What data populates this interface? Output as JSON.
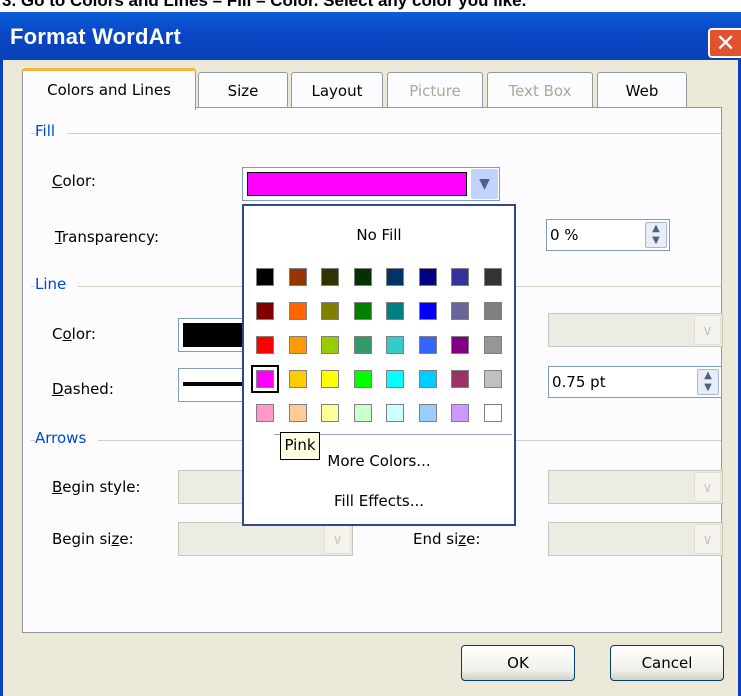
{
  "header": {
    "instruction_fragment": "3. Go to Colors and Lines – Fill – Color. Select any color you like."
  },
  "window": {
    "title": "Format WordArt",
    "close_glyph": "✕"
  },
  "tabs": [
    {
      "label": "Colors and Lines",
      "active": true,
      "enabled": true
    },
    {
      "label": "Size",
      "enabled": true
    },
    {
      "label": "Layout",
      "enabled": true
    },
    {
      "label": "Picture",
      "enabled": false
    },
    {
      "label": "Text Box",
      "enabled": false
    },
    {
      "label": "Web",
      "enabled": true
    }
  ],
  "fill": {
    "section_label": "Fill",
    "color_label": "Color:",
    "color_value": "#ff00ff",
    "transparency_label": "Transparency:",
    "transparency_value": "0 %"
  },
  "line": {
    "section_label": "Line",
    "color_label": "Color:",
    "color_value": "#000000",
    "dashed_label": "Dashed:",
    "weight_value": "0.75 pt"
  },
  "arrows": {
    "section_label": "Arrows",
    "begin_style_label": "Begin style:",
    "begin_size_label": "Begin size:",
    "end_size_label": "End size:"
  },
  "palette": {
    "no_fill_label": "No Fill",
    "rows": [
      [
        "#000000",
        "#993300",
        "#333300",
        "#003300",
        "#003366",
        "#000080",
        "#333399",
        "#333333"
      ],
      [
        "#800000",
        "#ff6600",
        "#808000",
        "#008000",
        "#008080",
        "#0000ff",
        "#666699",
        "#808080"
      ],
      [
        "#ff0000",
        "#ff9900",
        "#99cc00",
        "#339966",
        "#33cccc",
        "#3366ff",
        "#800080",
        "#969696"
      ],
      [
        "#ff00ff",
        "#ffcc00",
        "#ffff00",
        "#00ff00",
        "#00ffff",
        "#00ccff",
        "#993366",
        "#c0c0c0"
      ],
      [
        "#ff99cc",
        "#ffcc99",
        "#ffff99",
        "#ccffcc",
        "#ccffff",
        "#99ccff",
        "#cc99ff",
        "#ffffff"
      ]
    ],
    "selected": "#ff00ff",
    "more_colors_label": "More Colors...",
    "fill_effects_label": "Fill Effects...",
    "tooltip": "Pink"
  },
  "buttons": {
    "ok": "OK",
    "cancel": "Cancel"
  },
  "icons": {
    "dropdown_arrow": "chevron-down-icon",
    "spin": "spin-updown-icon",
    "close": "close-icon"
  }
}
